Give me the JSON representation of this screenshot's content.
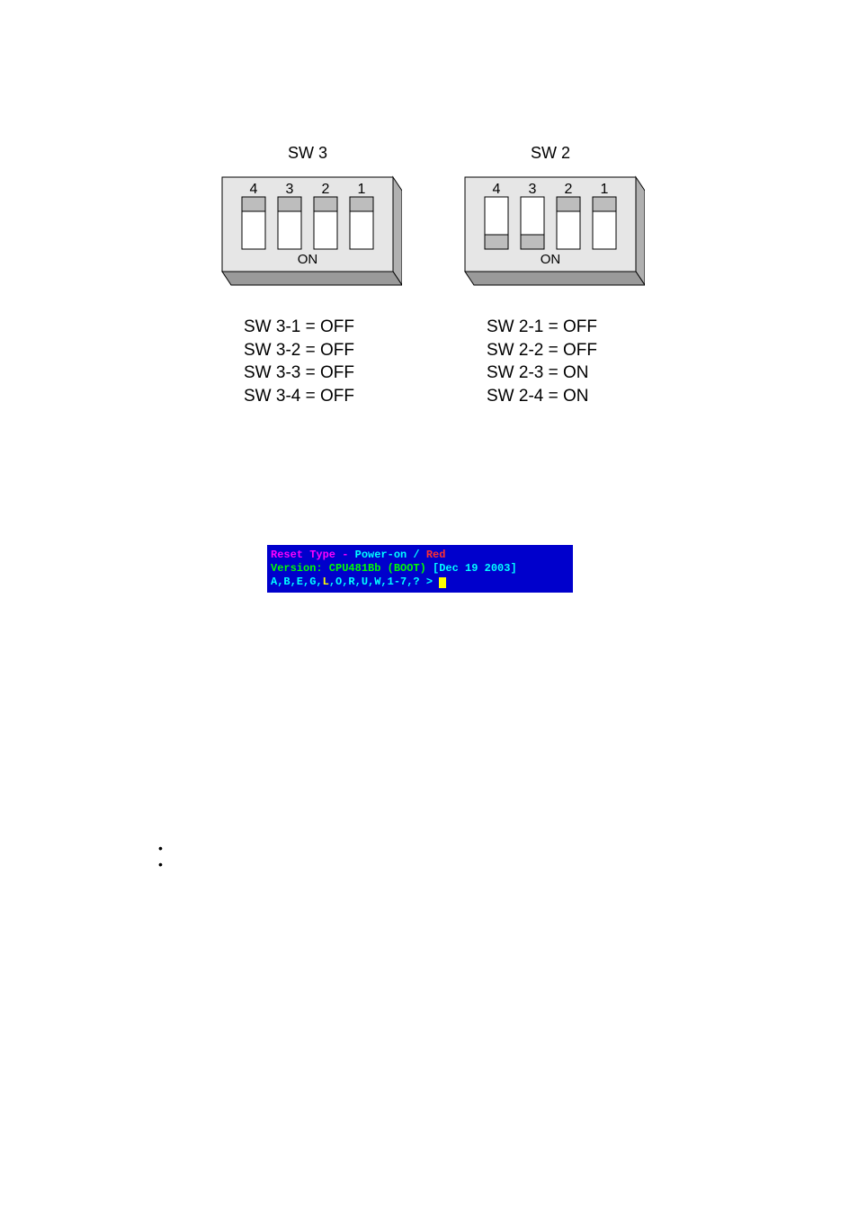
{
  "switches": [
    {
      "title": "SW 3",
      "slots": [
        {
          "num": "4",
          "on": false
        },
        {
          "num": "3",
          "on": false
        },
        {
          "num": "2",
          "on": false
        },
        {
          "num": "1",
          "on": false
        }
      ],
      "on_label": "ON",
      "states": [
        "SW 3-1 = OFF",
        "SW 3-2 = OFF",
        "SW 3-3 = OFF",
        "SW 3-4 = OFF"
      ]
    },
    {
      "title": "SW 2",
      "slots": [
        {
          "num": "4",
          "on": true
        },
        {
          "num": "3",
          "on": true
        },
        {
          "num": "2",
          "on": false
        },
        {
          "num": "1",
          "on": false
        }
      ],
      "on_label": "ON",
      "states": [
        "SW 2-1 = OFF",
        "SW 2-2 = OFF",
        "SW 2-3 = ON",
        "SW 2-4 = ON"
      ]
    }
  ],
  "terminal": {
    "l1a": "Reset Type - ",
    "l1b": "Power-on",
    "l1c": " / ",
    "l1d": "Red",
    "l2a": "Version: CPU481Bb (BOOT) ",
    "l2b": "[Dec 19 2003]",
    "l3a": "A,B,E,G,",
    "l3b": "L",
    "l3c": ",O,R,U,W,1-7,? > "
  },
  "bullets": [
    "•",
    "•"
  ]
}
